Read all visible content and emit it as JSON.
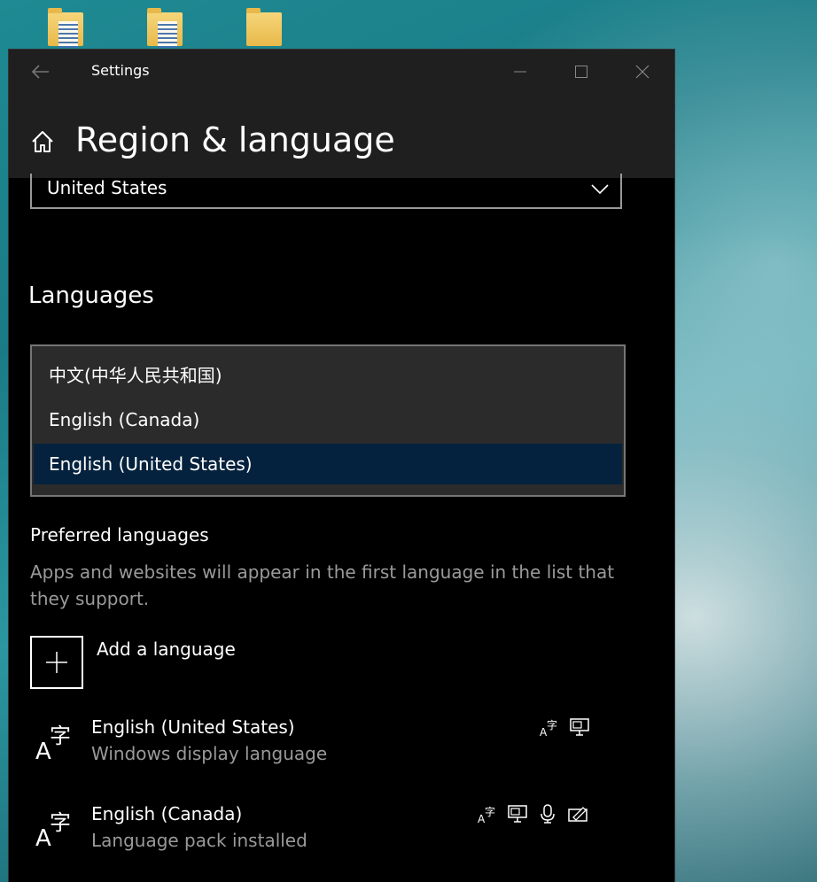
{
  "window": {
    "title": "Settings",
    "page_title": "Region & language"
  },
  "region": {
    "selected_country": "United States"
  },
  "languages": {
    "section_title": "Languages",
    "dropdown_options": [
      {
        "label": "中文(中华人民共和国)",
        "selected": false
      },
      {
        "label": "English (Canada)",
        "selected": false
      },
      {
        "label": "English (United States)",
        "selected": true
      }
    ],
    "preferred_heading": "Preferred languages",
    "preferred_description": "Apps and websites will appear in the first language in the list that they support.",
    "add_language_label": "Add a language",
    "installed": [
      {
        "name": "English (United States)",
        "status": "Windows display language",
        "features": [
          "language-pack-icon",
          "display-language-icon"
        ]
      },
      {
        "name": "English (Canada)",
        "status": "Language pack installed",
        "features": [
          "language-pack-icon",
          "display-language-icon",
          "speech-icon",
          "handwriting-icon"
        ]
      }
    ]
  },
  "colors": {
    "window_bg": "#000000",
    "titlebar_bg": "#1f1f1f",
    "selected_item_bg": "#04223d",
    "dropdown_bg": "#2b2b2b",
    "secondary_text": "#9a9a9a"
  }
}
